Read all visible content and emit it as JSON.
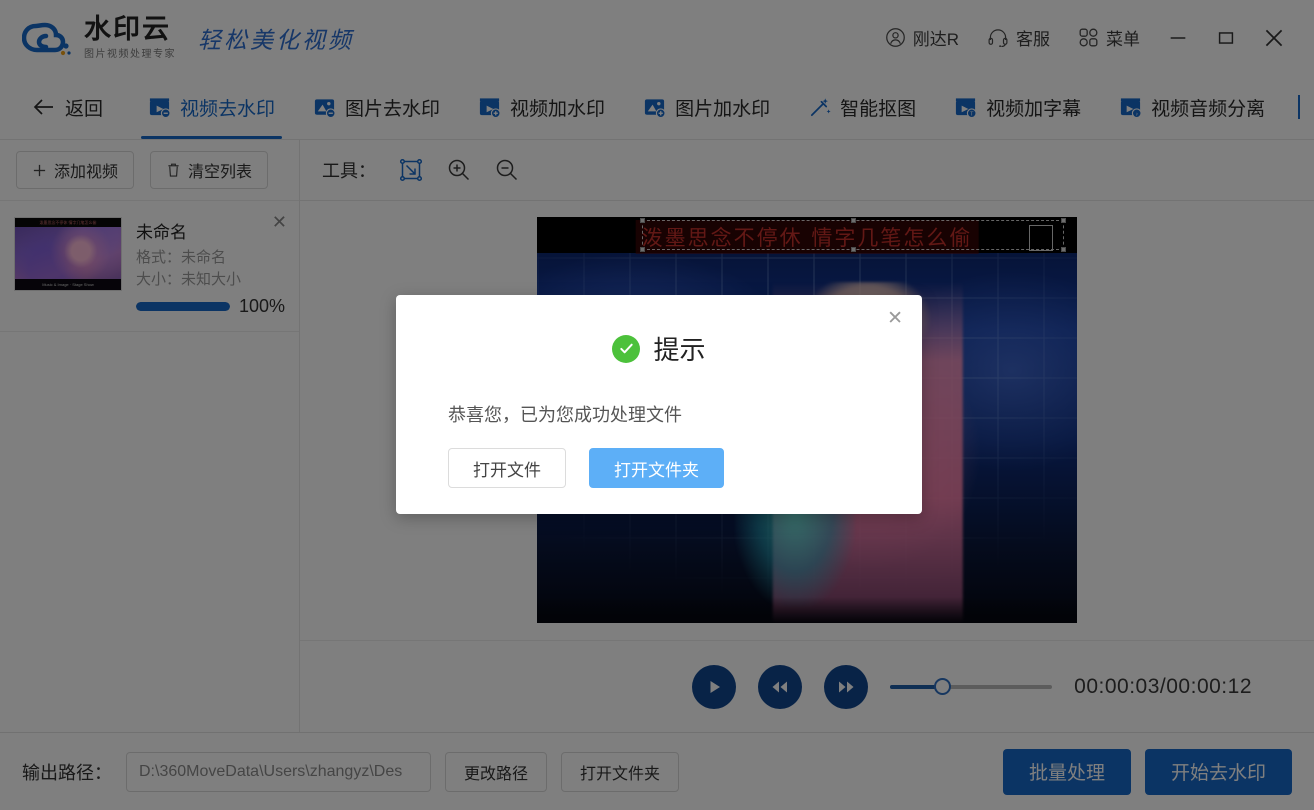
{
  "header": {
    "brand_name": "水印云",
    "brand_sub": "图片视频处理专家",
    "slogan": "轻松美化视频",
    "user_label": "刚达R",
    "support_label": "客服",
    "menu_label": "菜单",
    "minimize_label": "—",
    "maximize_label": "□",
    "close_label": "✕"
  },
  "nav": {
    "back_label": "返回",
    "items": [
      {
        "label": "视频去水印",
        "icon": "video-remove-watermark-icon",
        "active": true
      },
      {
        "label": "图片去水印",
        "icon": "image-remove-watermark-icon",
        "active": false
      },
      {
        "label": "视频加水印",
        "icon": "video-add-watermark-icon",
        "active": false
      },
      {
        "label": "图片加水印",
        "icon": "image-add-watermark-icon",
        "active": false
      },
      {
        "label": "智能抠图",
        "icon": "magic-wand-icon",
        "active": false
      },
      {
        "label": "视频加字幕",
        "icon": "video-subtitle-icon",
        "active": false
      },
      {
        "label": "视频音频分离",
        "icon": "video-audio-split-icon",
        "active": false
      }
    ]
  },
  "sidebar": {
    "add_button": "添加视频",
    "clear_button": "清空列表",
    "file": {
      "name": "未命名",
      "format_line": "格式：未命名",
      "size_line": "大小：未知大小",
      "progress_percent": "100%",
      "progress_value": 100,
      "thumb_top_text": "泼墨思念不停休 情字几笔怎么偷",
      "thumb_bottom_text": "Music & Image · Stage Show"
    }
  },
  "toolbar": {
    "label": "工具：",
    "tools": [
      {
        "name": "select-region-tool",
        "active": true
      },
      {
        "name": "zoom-in-tool",
        "active": false
      },
      {
        "name": "zoom-out-tool",
        "active": false
      }
    ]
  },
  "preview": {
    "subtitle_text": "泼墨思念不停休 情字几笔怎么偷"
  },
  "player": {
    "play_label": "播放",
    "rewind_label": "快退",
    "forward_label": "快进",
    "time_display": "00:00:03/00:00:12",
    "current_time": "00:00:03",
    "total_time": "00:00:12",
    "progress_percent": 32
  },
  "footer": {
    "output_path_label": "输出路径：",
    "output_path_value": "D:\\360MoveData\\Users\\zhangyz\\Des",
    "change_path_button": "更改路径",
    "open_folder_button": "打开文件夹",
    "batch_button": "批量处理",
    "start_button": "开始去水印"
  },
  "dialog": {
    "title": "提示",
    "message": "恭喜您，已为您成功处理文件",
    "open_file_button": "打开文件",
    "open_folder_button": "打开文件夹",
    "close_label": "✕"
  },
  "colors": {
    "accent_blue": "#1668c8",
    "dialog_blue": "#5daff7",
    "success_green": "#4cc13b",
    "player_blue": "#10468f"
  }
}
